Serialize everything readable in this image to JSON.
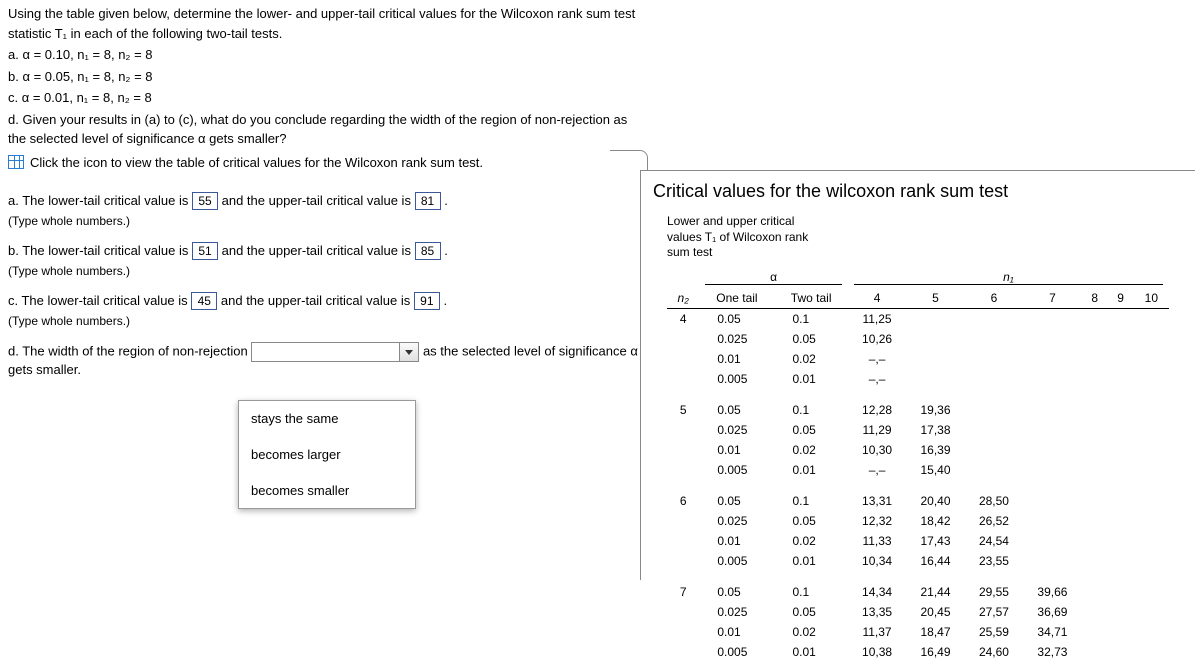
{
  "question": {
    "intro": "Using the table given below, determine the lower- and upper-tail critical values for the Wilcoxon rank sum test statistic T₁ in each of the following two-tail tests.",
    "a": "a. α = 0.10, n₁ = 8, n₂ = 8",
    "b": "b. α = 0.05, n₁ = 8, n₂ = 8",
    "c": "c. α = 0.01, n₁ = 8, n₂ = 8",
    "d": "d. Given your results in (a) to (c), what do you conclude regarding the width of the region of non-rejection as the selected level of significance α gets smaller?",
    "link": "Click the icon to view the table of critical values for the Wilcoxon rank sum test."
  },
  "answers": {
    "a_prefix": "a. The lower-tail critical value is ",
    "a_mid": " and the upper-tail critical value is ",
    "a_low": "55",
    "a_high": "81",
    "b_prefix": "b. The lower-tail critical value is ",
    "b_low": "51",
    "b_high": "85",
    "c_prefix": "c. The lower-tail critical value is ",
    "c_low": "45",
    "c_high": "91",
    "hint": "(Type whole numbers.)",
    "d_prefix": "d. The width of the region of non-rejection ",
    "d_suffix": " as the selected level of significance α gets smaller.",
    "d_value": ""
  },
  "options": {
    "o1": "stays the same",
    "o2": "becomes larger",
    "o3": "becomes smaller"
  },
  "panel": {
    "title": "Critical values for the wilcoxon rank sum test",
    "caption1": "Lower and upper critical",
    "caption2": "values T₁ of Wilcoxon rank",
    "caption3": "sum test",
    "alpha": "α",
    "n1": "n₁",
    "n2": "n₂",
    "one_tail": "One tail",
    "two_tail": "Two tail",
    "cols": {
      "c4": "4",
      "c5": "5",
      "c6": "6",
      "c7": "7",
      "c8": "8",
      "c9": "9",
      "c10": "10"
    }
  },
  "chart_data": {
    "type": "table",
    "description": "Critical values (lower,upper) for Wilcoxon rank sum test. Rows indexed by n2 and alpha levels; columns by n1.",
    "columns_n1": [
      4,
      5,
      6,
      7,
      8,
      9,
      10
    ],
    "one_tail_alpha": [
      0.05,
      0.025,
      0.01,
      0.005
    ],
    "two_tail_alpha": [
      0.1,
      0.05,
      0.02,
      0.01
    ],
    "groups": [
      {
        "n2": 4,
        "rows": [
          {
            "one": 0.05,
            "two": 0.1,
            "vals": [
              "11,25",
              "",
              "",
              "",
              "",
              "",
              ""
            ]
          },
          {
            "one": 0.025,
            "two": 0.05,
            "vals": [
              "10,26",
              "",
              "",
              "",
              "",
              "",
              ""
            ]
          },
          {
            "one": 0.01,
            "two": 0.02,
            "vals": [
              "–,–",
              "",
              "",
              "",
              "",
              "",
              ""
            ]
          },
          {
            "one": 0.005,
            "two": 0.01,
            "vals": [
              "–,–",
              "",
              "",
              "",
              "",
              "",
              ""
            ]
          }
        ]
      },
      {
        "n2": 5,
        "rows": [
          {
            "one": 0.05,
            "two": 0.1,
            "vals": [
              "12,28",
              "19,36",
              "",
              "",
              "",
              "",
              ""
            ]
          },
          {
            "one": 0.025,
            "two": 0.05,
            "vals": [
              "11,29",
              "17,38",
              "",
              "",
              "",
              "",
              ""
            ]
          },
          {
            "one": 0.01,
            "two": 0.02,
            "vals": [
              "10,30",
              "16,39",
              "",
              "",
              "",
              "",
              ""
            ]
          },
          {
            "one": 0.005,
            "two": 0.01,
            "vals": [
              "–,–",
              "15,40",
              "",
              "",
              "",
              "",
              ""
            ]
          }
        ]
      },
      {
        "n2": 6,
        "rows": [
          {
            "one": 0.05,
            "two": 0.1,
            "vals": [
              "13,31",
              "20,40",
              "28,50",
              "",
              "",
              "",
              ""
            ]
          },
          {
            "one": 0.025,
            "two": 0.05,
            "vals": [
              "12,32",
              "18,42",
              "26,52",
              "",
              "",
              "",
              ""
            ]
          },
          {
            "one": 0.01,
            "two": 0.02,
            "vals": [
              "11,33",
              "17,43",
              "24,54",
              "",
              "",
              "",
              ""
            ]
          },
          {
            "one": 0.005,
            "two": 0.01,
            "vals": [
              "10,34",
              "16,44",
              "23,55",
              "",
              "",
              "",
              ""
            ]
          }
        ]
      },
      {
        "n2": 7,
        "rows": [
          {
            "one": 0.05,
            "two": 0.1,
            "vals": [
              "14,34",
              "21,44",
              "29,55",
              "39,66",
              "",
              "",
              ""
            ]
          },
          {
            "one": 0.025,
            "two": 0.05,
            "vals": [
              "13,35",
              "20,45",
              "27,57",
              "36,69",
              "",
              "",
              ""
            ]
          },
          {
            "one": 0.01,
            "two": 0.02,
            "vals": [
              "11,37",
              "18,47",
              "25,59",
              "34,71",
              "",
              "",
              ""
            ]
          },
          {
            "one": 0.005,
            "two": 0.01,
            "vals": [
              "10,38",
              "16,49",
              "24,60",
              "32,73",
              "",
              "",
              ""
            ]
          }
        ]
      }
    ]
  }
}
